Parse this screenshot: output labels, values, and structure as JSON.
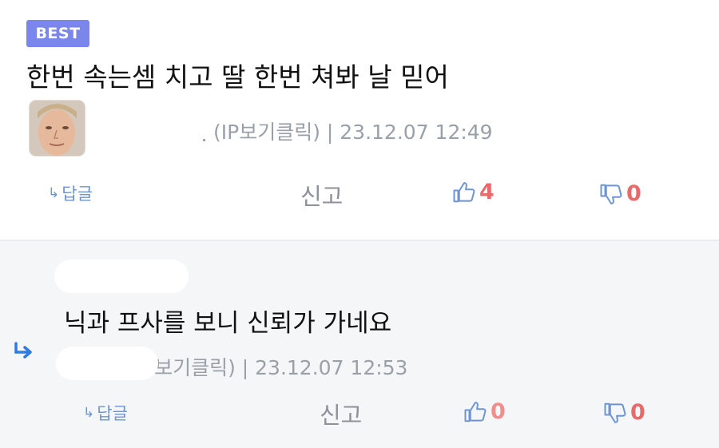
{
  "comment1": {
    "badge": "BEST",
    "text": "한번 속는셈 치고 딸 한번 쳐봐 날 믿어",
    "meta": "(IP보기클릭) | 23.12.07 12:49",
    "reply_label": "답글",
    "report_label": "신고",
    "likes": "4",
    "dislikes": "0"
  },
  "comment2": {
    "text": "닉과 프사를 보니 신뢰가 가네요",
    "meta": "P보기클릭) | 23.12.07 12:53",
    "reply_label": "답글",
    "report_label": "신고",
    "likes": "0",
    "dislikes": "0"
  },
  "colors": {
    "badge": "#7b86ea",
    "accent_blue": "#6e95d2",
    "count_red": "#e86a6a",
    "reply_arrow": "#2f7be0"
  }
}
